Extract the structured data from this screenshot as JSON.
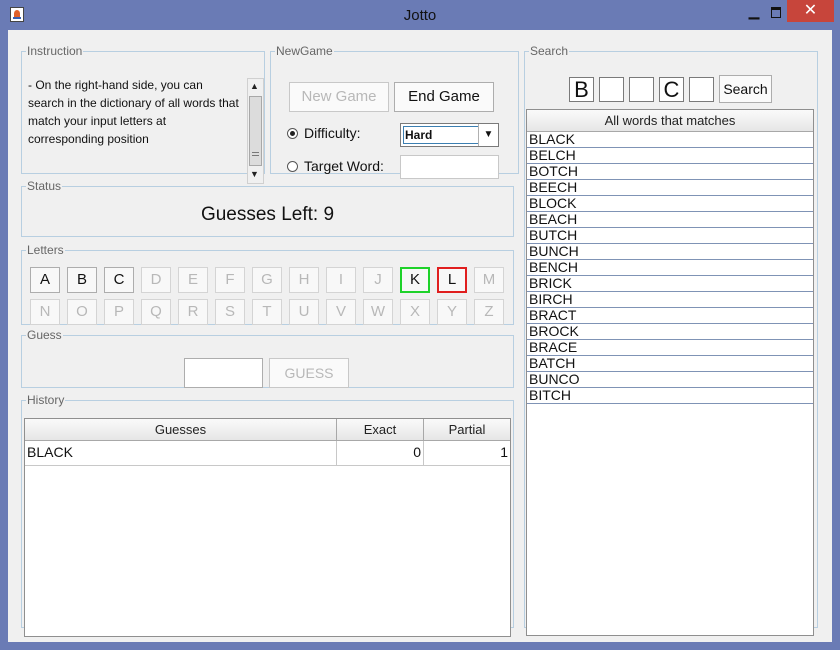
{
  "window": {
    "title": "Jotto",
    "minimize": "▁",
    "close": "✕"
  },
  "instruction": {
    "legend": "Instruction",
    "lines": [
      "- On the right-hand side, you can",
      "search in the dictionary of all words that",
      "match your input letters at",
      "corresponding position"
    ]
  },
  "newgame": {
    "legend": "NewGame",
    "new_game_label": "New Game",
    "end_game_label": "End Game",
    "difficulty_label": "Difficulty:",
    "difficulty_value": "Hard",
    "target_word_label": "Target Word:",
    "target_word_value": ""
  },
  "status": {
    "legend": "Status",
    "text": "Guesses Left: 9"
  },
  "letters": {
    "legend": "Letters",
    "row1": [
      "A",
      "B",
      "C",
      "D",
      "E",
      "F",
      "G",
      "H",
      "I",
      "J",
      "K",
      "L",
      "M"
    ],
    "row2": [
      "N",
      "O",
      "P",
      "Q",
      "R",
      "S",
      "T",
      "U",
      "V",
      "W",
      "X",
      "Y",
      "Z"
    ]
  },
  "guess": {
    "legend": "Guess",
    "input_value": "",
    "button_label": "GUESS"
  },
  "history": {
    "legend": "History",
    "columns": [
      "Guesses",
      "Exact",
      "Partial"
    ],
    "rows": [
      {
        "word": "BLACK",
        "exact": "0",
        "partial": "1"
      }
    ]
  },
  "search": {
    "legend": "Search",
    "inputs": [
      "B",
      "",
      "",
      "C",
      ""
    ],
    "button_label": "Search",
    "results_header": "All words that matches",
    "results": [
      "BLACK",
      "BELCH",
      "BOTCH",
      "BEECH",
      "BLOCK",
      "BEACH",
      "BUTCH",
      "BUNCH",
      "BENCH",
      "BRICK",
      "BIRCH",
      "BRACT",
      "BROCK",
      "BRACE",
      "BATCH",
      "BUNCO",
      "BITCH"
    ]
  }
}
